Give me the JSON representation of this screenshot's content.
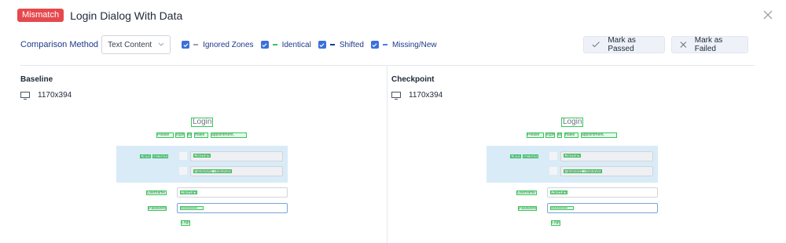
{
  "header": {
    "badge": "Mismatch",
    "title": "Login Dialog With Data"
  },
  "toolbar": {
    "method_label": "Comparison Method",
    "method_value": "Text Content",
    "legend": [
      {
        "label": "Ignored Zones",
        "color": "#9ca3af"
      },
      {
        "label": "Identical",
        "color": "#34c759"
      },
      {
        "label": "Shifted",
        "color": "#1e3a8a"
      },
      {
        "label": "Missing/New",
        "color": "#3b82f6"
      }
    ],
    "pass_label": "Mark as Passed",
    "fail_label": "Mark as Failed"
  },
  "baseline": {
    "title": "Baseline",
    "dimensions": "1170x394"
  },
  "checkpoint": {
    "title": "Checkpoint",
    "dimensions": "1170x394"
  },
  "preview": {
    "login_title": "Login",
    "subtitle_words": [
      "Please",
      "login",
      "to",
      "make",
      "appointment."
    ],
    "demo_label_words": [
      "Demo",
      "account"
    ],
    "demo_username": "Username: John Doe",
    "demo_password": "Password: ThisIsNotAPassword",
    "username_label": "Username",
    "password_label": "Password",
    "password_mask": "••••••••••••",
    "login_button": "Login"
  },
  "icons": {
    "close": "close-icon",
    "chevron": "chevron-down-icon",
    "check": "check-icon",
    "x": "x-icon",
    "monitor": "monitor-icon"
  }
}
